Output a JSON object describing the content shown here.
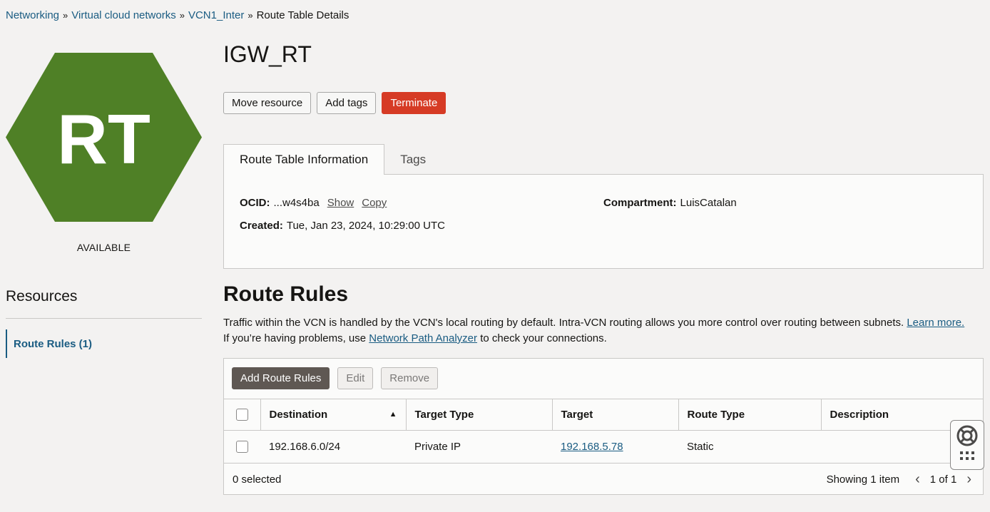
{
  "breadcrumb": {
    "items": [
      "Networking",
      "Virtual cloud networks",
      "VCN1_Inter"
    ],
    "separator": "»",
    "current": "Route Table Details"
  },
  "resource_icon": {
    "label": "RT",
    "color": "#4f8026"
  },
  "status": "AVAILABLE",
  "title": "IGW_RT",
  "actions": {
    "move": "Move resource",
    "add_tags": "Add tags",
    "terminate": "Terminate"
  },
  "tabs": [
    "Route Table Information",
    "Tags"
  ],
  "info": {
    "ocid_label": "OCID:",
    "ocid_value": "...w4s4ba",
    "show": "Show",
    "copy": "Copy",
    "created_label": "Created:",
    "created_value": "Tue, Jan 23, 2024, 10:29:00 UTC",
    "compartment_label": "Compartment:",
    "compartment_value": "LuisCatalan"
  },
  "resources": {
    "title": "Resources",
    "items": [
      "Route Rules (1)"
    ]
  },
  "route_rules": {
    "title": "Route Rules",
    "desc_1": "Traffic within the VCN is handled by the VCN's local routing by default. Intra-VCN routing allows you more control over routing between subnets.",
    "learn_more": "Learn more.",
    "desc_2_pre": "If you’re having problems, use",
    "analyzer_link": "Network Path Analyzer",
    "desc_2_post": "to check your connections.",
    "buttons": {
      "add": "Add Route Rules",
      "edit": "Edit",
      "remove": "Remove"
    },
    "columns": [
      "Destination",
      "Target Type",
      "Target",
      "Route Type",
      "Description"
    ],
    "rows": [
      {
        "destination": "192.168.6.0/24",
        "target_type": "Private IP",
        "target": "192.168.5.78",
        "route_type": "Static",
        "description": ""
      }
    ],
    "selected": "0 selected",
    "showing": "Showing 1 item",
    "page": "1 of 1"
  },
  "colors": {
    "link": "#1a5c82",
    "danger": "#d63b25",
    "primary_btn": "#5f5853",
    "hex_green": "#4f8026"
  }
}
